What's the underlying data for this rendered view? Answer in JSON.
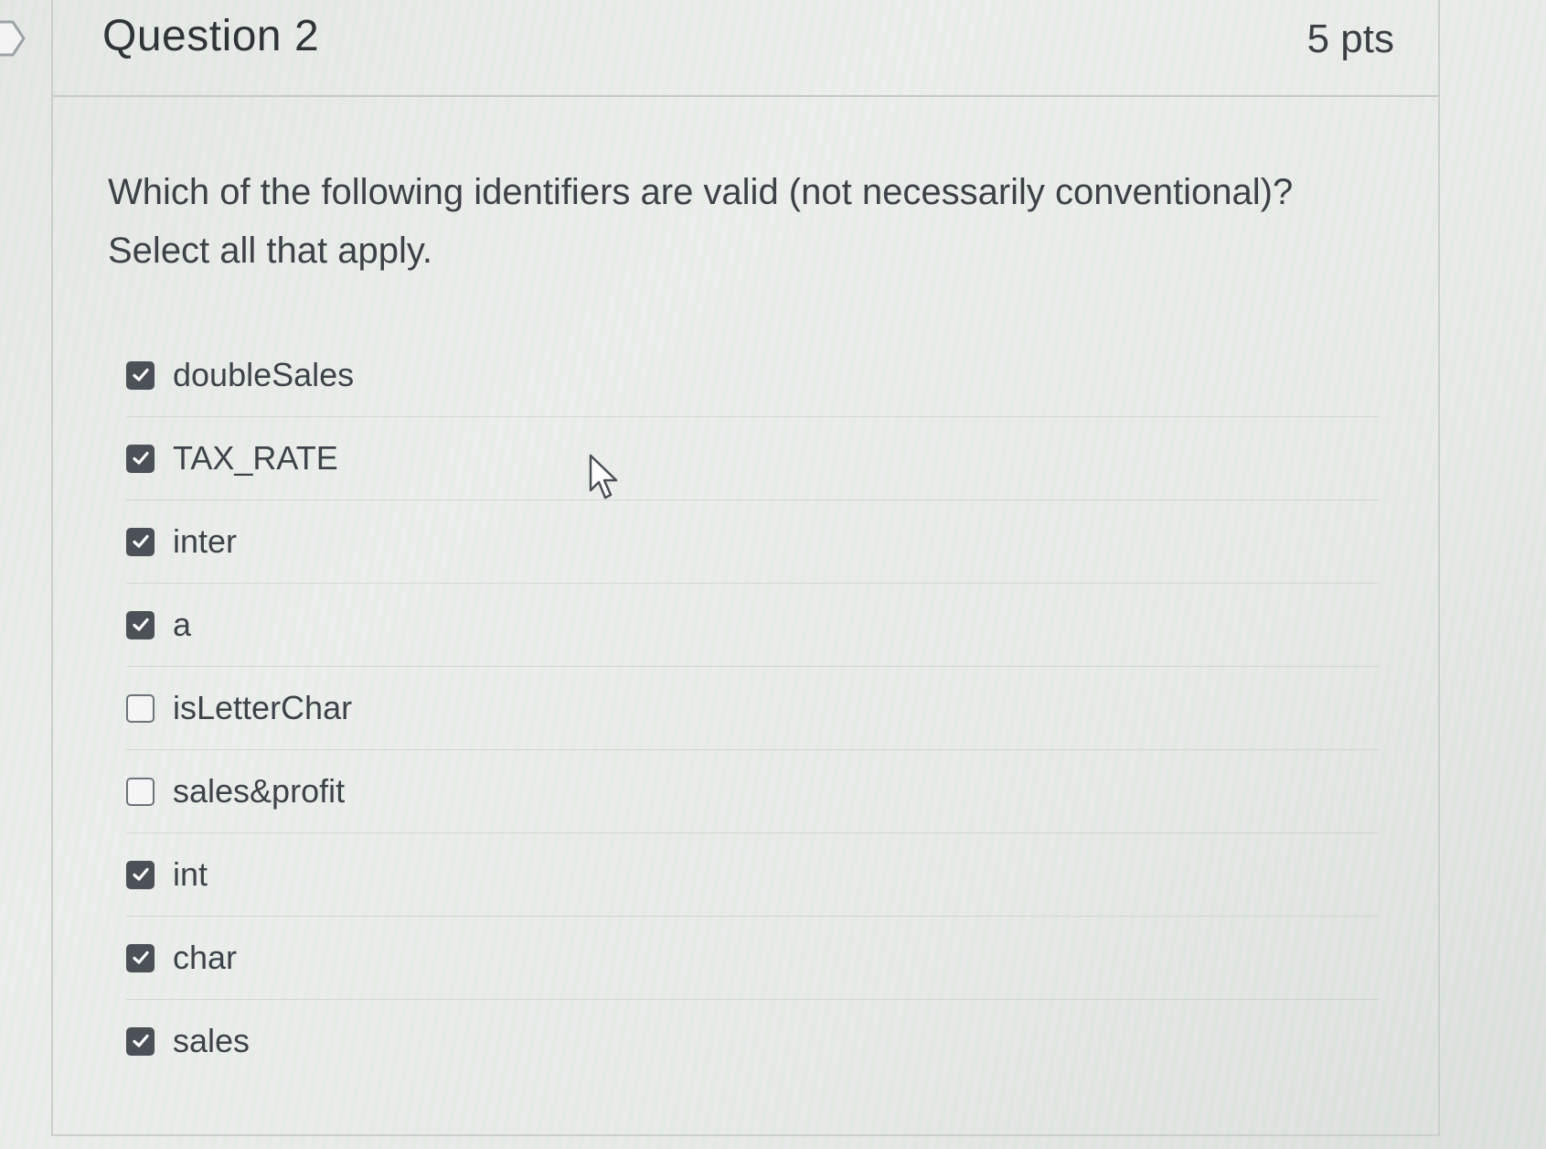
{
  "question": {
    "title": "Question 2",
    "points": "5 pts",
    "text_line1": "Which of the following identifiers are valid (not necessarily conventional)?",
    "text_line2": "Select all that apply."
  },
  "answers": [
    {
      "label": "doubleSales",
      "checked": true
    },
    {
      "label": "TAX_RATE",
      "checked": true
    },
    {
      "label": "inter",
      "checked": true
    },
    {
      "label": "a",
      "checked": true
    },
    {
      "label": "isLetterChar",
      "checked": false
    },
    {
      "label": "sales&profit",
      "checked": false
    },
    {
      "label": "int",
      "checked": true
    },
    {
      "label": "char",
      "checked": true
    },
    {
      "label": "sales",
      "checked": true
    }
  ]
}
